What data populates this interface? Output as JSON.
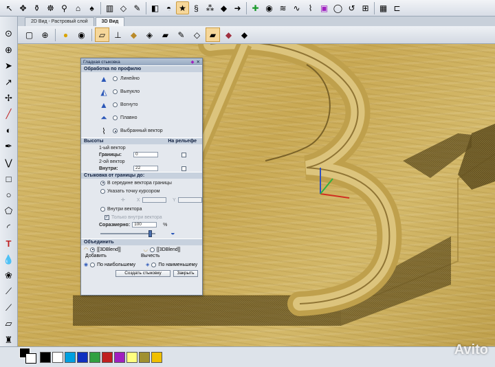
{
  "tabs": [
    {
      "label": "2D Вид - Растровый слой",
      "active": false
    },
    {
      "label": "3D Вид",
      "active": true
    }
  ],
  "dialog": {
    "title": "Гладкая стыковка",
    "profile_header": "Обработка по профилю",
    "profiles": [
      {
        "label": "Линейно",
        "selected": false
      },
      {
        "label": "Выпукло",
        "selected": false
      },
      {
        "label": "Вогнуто",
        "selected": false
      },
      {
        "label": "Плавно",
        "selected": false
      },
      {
        "label": "Выбранный вектор",
        "selected": true
      }
    ],
    "heights_header": "Высоты",
    "on_relief_header": "На рельефе",
    "vector1_label": "1-ый вектор",
    "border_label": "Границы:",
    "border_value": "0",
    "vector2_label": "2-ой вектор",
    "inside_label": "Внутри:",
    "inside_value": "22",
    "join_header": "Стыковка от границы до:",
    "join_options": [
      {
        "label": "В середине вектора границы",
        "selected": true
      },
      {
        "label": "Указать точку курсором",
        "selected": false
      }
    ],
    "x_label": "X",
    "y_label": "Y",
    "inside_vector_label": "Внутри вектора",
    "inside_vector_selected": false,
    "disabled_check_label": "Только внутри вектора",
    "proportional_label": "Соразмерно:",
    "proportional_value": "100",
    "percent": "%",
    "slider_level": 0.9,
    "merge_header": "Объединить",
    "merge_add_label": "Добавить",
    "merge_subtract_label": "Вычесть",
    "blend_label_1": "[[3DBlend]]",
    "blend_label_2": "[[3DBlend]]",
    "by_max_label": "По наибольшему",
    "by_min_label": "По наименьшему",
    "create_button": "Создать стыковку",
    "close_button": "Закрыть"
  },
  "palette": [
    "#000000",
    "#ffffff",
    "#00a0e0",
    "#1030c0",
    "#30a040",
    "#c02020",
    "#a020c0",
    "#ffff80",
    "#a09030",
    "#f0c000"
  ],
  "watermark": "Avito",
  "colors": {
    "wood": "#d4b96a",
    "accent_blue": "#2b57b8"
  }
}
